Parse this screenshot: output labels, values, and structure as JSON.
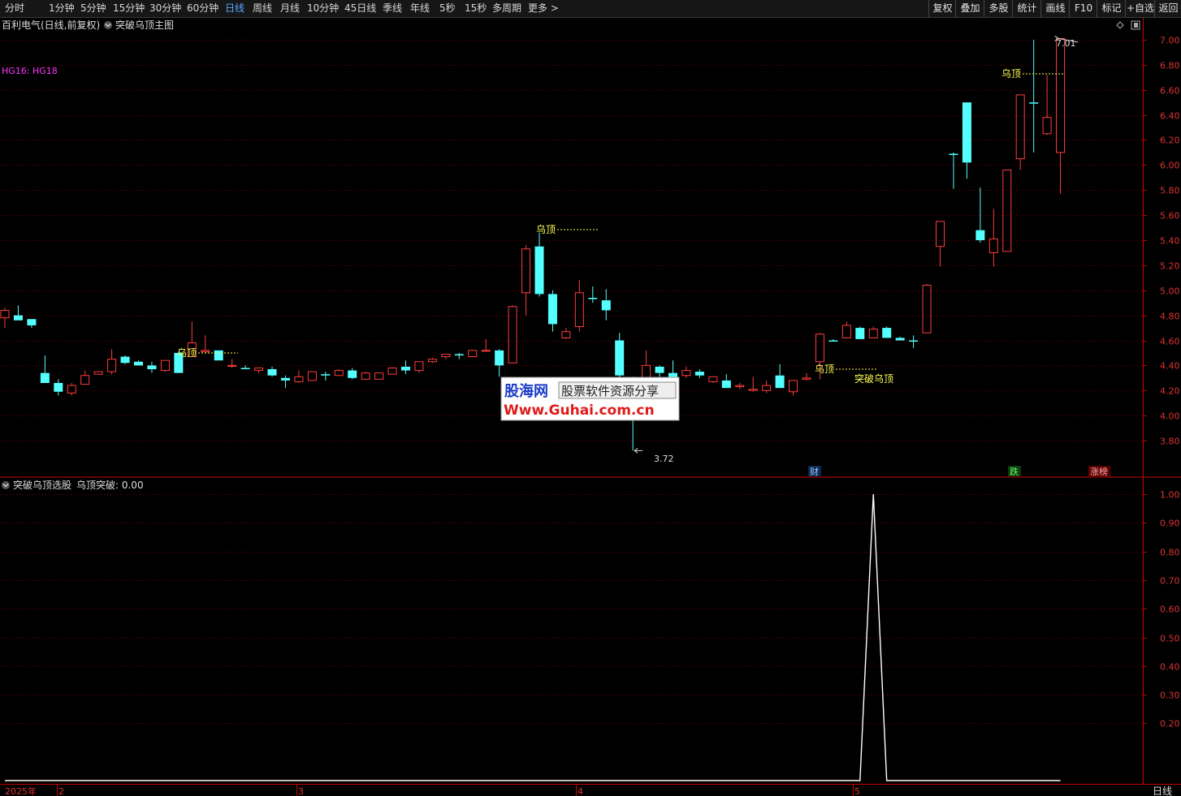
{
  "toolbar": {
    "periods": [
      {
        "label": "分时",
        "active": false
      },
      {
        "label": "1分钟",
        "active": false
      },
      {
        "label": "5分钟",
        "active": false
      },
      {
        "label": "15分钟",
        "active": false
      },
      {
        "label": "30分钟",
        "active": false
      },
      {
        "label": "60分钟",
        "active": false
      },
      {
        "label": "日线",
        "active": true
      },
      {
        "label": "周线",
        "active": false
      },
      {
        "label": "月线",
        "active": false
      },
      {
        "label": "10分钟",
        "active": false
      },
      {
        "label": "45日线",
        "active": false
      },
      {
        "label": "季线",
        "active": false
      },
      {
        "label": "年线",
        "active": false
      },
      {
        "label": "5秒",
        "active": false
      },
      {
        "label": "15秒",
        "active": false
      },
      {
        "label": "多周期",
        "active": false
      },
      {
        "label": "更多 >",
        "active": false
      }
    ],
    "actions": [
      "复权",
      "叠加",
      "多股",
      "统计",
      "画线",
      "F10",
      "标记",
      "+自选",
      "返回"
    ]
  },
  "main_chart": {
    "title": "百利电气(日线,前复权)",
    "indicator_name": "突破乌顶主图",
    "legend": "HG16: HG18",
    "high_label": "7.01",
    "low_label": "3.72",
    "yticks": [
      "7.00",
      "6.80",
      "6.60",
      "6.40",
      "6.20",
      "6.00",
      "5.80",
      "5.60",
      "5.40",
      "5.20",
      "5.00",
      "4.80",
      "4.60",
      "4.40",
      "4.20",
      "4.00",
      "3.80"
    ],
    "markers": [
      "财",
      "跌",
      "涨榜"
    ],
    "annotations": [
      "乌顶",
      "乌顶",
      "乌顶",
      "乌顶",
      "突破乌顶"
    ]
  },
  "watermark": {
    "line1_a": "股海网",
    "line1_b": "股票软件资源分享",
    "line2": "Www.Guhai.com.cn"
  },
  "sub_chart": {
    "title": "突破乌顶选股",
    "value_label": "乌顶突破: 0.00",
    "yticks": [
      "1.00",
      "0.90",
      "0.80",
      "0.70",
      "0.60",
      "0.50",
      "0.40",
      "0.30",
      "0.20"
    ]
  },
  "x_axis": {
    "labels": [
      "2025年",
      "2",
      "3",
      "4",
      "5"
    ],
    "period_label": "日线"
  },
  "colors": {
    "up": "#ff3c3c",
    "down": "#54ffff",
    "grid": "#7a0000",
    "axis": "#c80000",
    "annotation": "#ffff55",
    "legend": "#ff33ff"
  },
  "chart_data": {
    "type": "candlestick",
    "ylim": [
      3.65,
      7.1
    ],
    "candles": [
      [
        4.78,
        4.86,
        4.7,
        4.84
      ],
      [
        4.8,
        4.88,
        4.77,
        4.76
      ],
      [
        4.77,
        4.76,
        4.7,
        4.72
      ],
      [
        4.34,
        4.48,
        4.26,
        4.26
      ],
      [
        4.26,
        4.29,
        4.16,
        4.19
      ],
      [
        4.18,
        4.26,
        4.16,
        4.24
      ],
      [
        4.25,
        4.36,
        4.25,
        4.32
      ],
      [
        4.33,
        4.35,
        4.33,
        4.35
      ],
      [
        4.35,
        4.53,
        4.33,
        4.45
      ],
      [
        4.47,
        4.48,
        4.41,
        4.42
      ],
      [
        4.43,
        4.44,
        4.41,
        4.4
      ],
      [
        4.4,
        4.43,
        4.34,
        4.37
      ],
      [
        4.36,
        4.42,
        4.35,
        4.44
      ],
      [
        4.5,
        4.51,
        4.35,
        4.34
      ],
      [
        4.47,
        4.75,
        4.47,
        4.58
      ],
      [
        4.51,
        4.64,
        4.5,
        4.52
      ],
      [
        4.52,
        4.52,
        4.44,
        4.44
      ],
      [
        4.4,
        4.45,
        4.38,
        4.4
      ],
      [
        4.38,
        4.4,
        4.37,
        4.37
      ],
      [
        4.36,
        4.38,
        4.34,
        4.38
      ],
      [
        4.37,
        4.39,
        4.31,
        4.32
      ],
      [
        4.3,
        4.32,
        4.22,
        4.28
      ],
      [
        4.27,
        4.36,
        4.26,
        4.31
      ],
      [
        4.28,
        4.35,
        4.28,
        4.35
      ],
      [
        4.33,
        4.35,
        4.28,
        4.32
      ],
      [
        4.32,
        4.37,
        4.32,
        4.36
      ],
      [
        4.36,
        4.38,
        4.29,
        4.3
      ],
      [
        4.29,
        4.35,
        4.29,
        4.34
      ],
      [
        4.29,
        4.34,
        4.29,
        4.34
      ],
      [
        4.33,
        4.37,
        4.33,
        4.38
      ],
      [
        4.39,
        4.44,
        4.33,
        4.36
      ],
      [
        4.36,
        4.43,
        4.34,
        4.43
      ],
      [
        4.43,
        4.46,
        4.42,
        4.45
      ],
      [
        4.47,
        4.49,
        4.45,
        4.49
      ],
      [
        4.49,
        4.5,
        4.45,
        4.48
      ],
      [
        4.47,
        4.52,
        4.47,
        4.52
      ],
      [
        4.52,
        4.61,
        4.51,
        4.52
      ],
      [
        4.52,
        4.53,
        4.31,
        4.4
      ],
      [
        4.42,
        4.88,
        4.42,
        4.87
      ],
      [
        4.98,
        5.36,
        4.8,
        5.33
      ],
      [
        5.35,
        5.46,
        4.95,
        4.97
      ],
      [
        4.97,
        5.0,
        4.67,
        4.73
      ],
      [
        4.62,
        4.7,
        4.61,
        4.67
      ],
      [
        4.71,
        5.08,
        4.67,
        4.98
      ],
      [
        4.94,
        5.03,
        4.9,
        4.93
      ],
      [
        4.92,
        5.01,
        4.76,
        4.84
      ],
      [
        4.6,
        4.66,
        4.27,
        4.32
      ],
      [
        4.3,
        4.31,
        3.72,
        4.1
      ],
      [
        4.3,
        4.52,
        4.28,
        4.4
      ],
      [
        4.39,
        4.4,
        4.31,
        4.34
      ],
      [
        4.34,
        4.44,
        4.22,
        4.29
      ],
      [
        4.32,
        4.39,
        4.3,
        4.36
      ],
      [
        4.35,
        4.37,
        4.3,
        4.32
      ],
      [
        4.27,
        4.31,
        4.26,
        4.31
      ],
      [
        4.28,
        4.33,
        4.24,
        4.22
      ],
      [
        4.23,
        4.26,
        4.21,
        4.24
      ],
      [
        4.2,
        4.31,
        4.19,
        4.21
      ],
      [
        4.2,
        4.28,
        4.18,
        4.24
      ],
      [
        4.32,
        4.41,
        4.24,
        4.22
      ],
      [
        4.19,
        4.27,
        4.16,
        4.28
      ],
      [
        4.29,
        4.34,
        4.28,
        4.3
      ],
      [
        4.43,
        4.66,
        4.29,
        4.65
      ],
      [
        4.6,
        4.61,
        4.6,
        4.59
      ],
      [
        4.62,
        4.75,
        4.62,
        4.72
      ],
      [
        4.7,
        4.71,
        4.62,
        4.61
      ],
      [
        4.62,
        4.71,
        4.62,
        4.69
      ],
      [
        4.7,
        4.71,
        4.62,
        4.62
      ],
      [
        4.62,
        4.63,
        4.62,
        4.6
      ],
      [
        4.6,
        4.64,
        4.54,
        4.59
      ],
      [
        4.66,
        5.05,
        4.66,
        5.04
      ],
      [
        5.35,
        5.55,
        5.19,
        5.55
      ],
      [
        6.09,
        6.1,
        5.81,
        6.08
      ],
      [
        6.5,
        6.5,
        5.89,
        6.02
      ],
      [
        5.48,
        5.82,
        5.38,
        5.4
      ],
      [
        5.3,
        5.65,
        5.19,
        5.41
      ],
      [
        5.31,
        5.96,
        5.31,
        5.96
      ],
      [
        6.05,
        6.56,
        5.96,
        6.56
      ],
      [
        6.5,
        7.0,
        6.1,
        6.49
      ],
      [
        6.25,
        6.72,
        6.24,
        6.38
      ],
      [
        6.1,
        7.01,
        5.77,
        7.01
      ]
    ],
    "signal": {
      "index": 65,
      "value": 1
    }
  }
}
